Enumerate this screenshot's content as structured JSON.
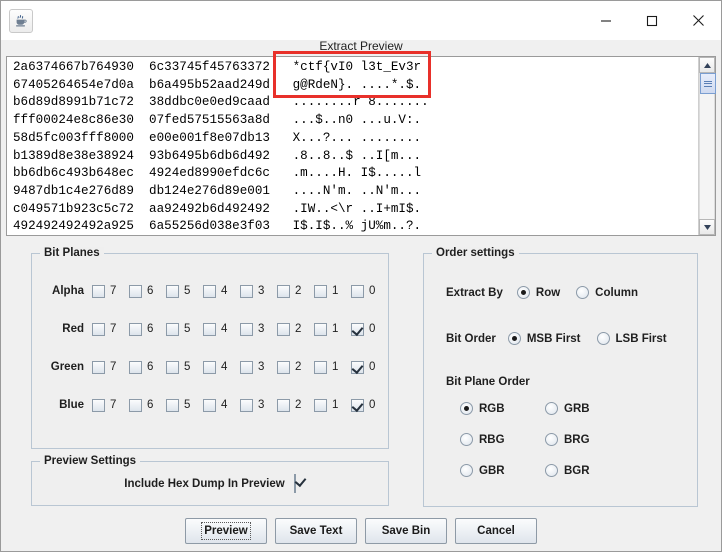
{
  "window": {
    "app_icon": "java-coffee-cup-icon",
    "title": "",
    "minimize_label": "—",
    "maximize_label": "□",
    "close_label": "✕"
  },
  "header": {
    "title": "Extract Preview"
  },
  "preview": {
    "hex_dump": "2a6374667b764930  6c33745f45763372   *ctf{vI0 l3t_Ev3r\n67405264654e7d0a  b6a495b52aad249d   g@RdeN}. ....*.$.\nb6d89d8991b71c72  38ddbc0e0ed9caad   ........r 8.......\nfff00024e8c86e30  07fed57515563a8d   ...$..n0 ...u.V:.\n58d5fc003fff8000  e00e001f8e07db13   X...?... ........\nb1389d8e38e38924  93b6495b6db6d492   .8..8..$ ..I[m...\nbb6db6c493b648ec  4924ed8990efdc6c   .m....H. I$.....l\n9487db1c4e276d89  db124e276d89e001   ....N'm. ..N'm...\nc049571b923c5c72  aa92492b6d492492   .IW..<\\r ..I+mI$.\n492492492492a925  6a55256d038e3f03   I$.I$..% jU%m..?.",
    "annotation": {
      "color": "#e8302a",
      "highlighted_text": "*ctf{vI0 l3t_Ev3r g@RdeN}."
    },
    "scrollbar": {
      "up_arrow": "scroll-up-icon",
      "down_arrow": "scroll-down-icon"
    }
  },
  "bit_planes": {
    "legend": "Bit Planes",
    "bit_labels": [
      "7",
      "6",
      "5",
      "4",
      "3",
      "2",
      "1",
      "0"
    ],
    "channels": [
      {
        "name": "Alpha",
        "checked": [
          false,
          false,
          false,
          false,
          false,
          false,
          false,
          false
        ]
      },
      {
        "name": "Red",
        "checked": [
          false,
          false,
          false,
          false,
          false,
          false,
          false,
          true
        ]
      },
      {
        "name": "Green",
        "checked": [
          false,
          false,
          false,
          false,
          false,
          false,
          false,
          true
        ]
      },
      {
        "name": "Blue",
        "checked": [
          false,
          false,
          false,
          false,
          false,
          false,
          false,
          true
        ]
      }
    ]
  },
  "order_settings": {
    "legend": "Order settings",
    "extract_by": {
      "label": "Extract By",
      "options": [
        "Row",
        "Column"
      ],
      "selected": "Row"
    },
    "bit_order": {
      "label": "Bit Order",
      "options": [
        "MSB First",
        "LSB First"
      ],
      "selected": "MSB First"
    },
    "bit_plane_order": {
      "label": "Bit Plane Order",
      "options": [
        "RGB",
        "GRB",
        "RBG",
        "BRG",
        "GBR",
        "BGR"
      ],
      "selected": "RGB"
    }
  },
  "preview_settings": {
    "legend": "Preview Settings",
    "include_hex_dump": {
      "label": "Include Hex Dump In Preview",
      "checked": true
    }
  },
  "buttons": [
    {
      "label": "Preview",
      "focused": true
    },
    {
      "label": "Save Text",
      "focused": false
    },
    {
      "label": "Save Bin",
      "focused": false
    },
    {
      "label": "Cancel",
      "focused": false
    }
  ]
}
